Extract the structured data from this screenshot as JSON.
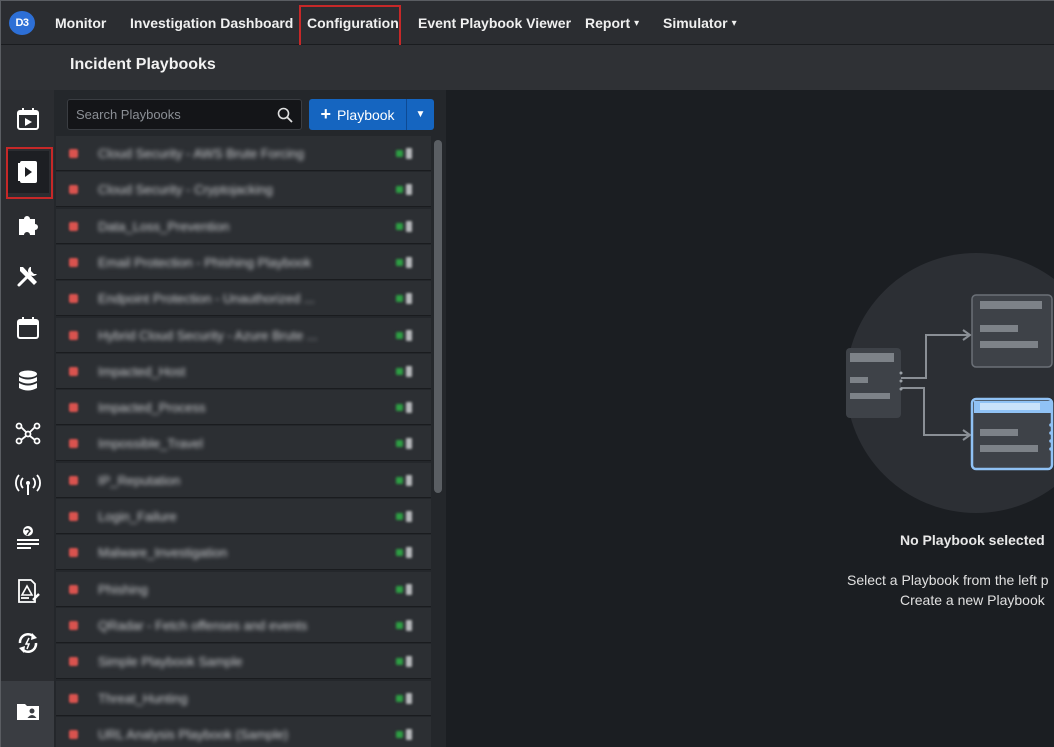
{
  "app": {
    "logo_text": "D3",
    "nav": [
      {
        "label": "Monitor",
        "has_caret": false
      },
      {
        "label": "Investigation Dashboard",
        "has_caret": false
      },
      {
        "label": "Configuration",
        "has_caret": false
      },
      {
        "label": "Event Playbook Viewer",
        "has_caret": false
      },
      {
        "label": "Report",
        "has_caret": true
      },
      {
        "label": "Simulator",
        "has_caret": true
      }
    ],
    "caret_glyph": "▾"
  },
  "page": {
    "title": "Incident Playbooks"
  },
  "sidebar": {
    "icons": [
      "calendar-play-icon",
      "playbook-icon",
      "puzzle-icon",
      "tools-icon",
      "calendar-icon",
      "database-icon",
      "network-icon",
      "antenna-icon",
      "globe-list-icon",
      "report-edit-icon",
      "sync-icon",
      "folder-user-icon"
    ],
    "active_index": 1
  },
  "playbooks_panel": {
    "search_placeholder": "Search Playbooks",
    "add_button_label": "Playbook",
    "add_button_plus": "+",
    "add_dropdown_glyph": "▼",
    "items": [
      {
        "name": "Cloud Security - AWS Brute Forcing"
      },
      {
        "name": "Cloud Security - Cryptojacking"
      },
      {
        "name": "Data_Loss_Prevention"
      },
      {
        "name": "Email Protection - Phishing Playbook"
      },
      {
        "name": "Endpoint Protection - Unauthorized ..."
      },
      {
        "name": "Hybrid Cloud Security - Azure Brute ..."
      },
      {
        "name": "Impacted_Host"
      },
      {
        "name": "Impacted_Process"
      },
      {
        "name": "Impossible_Travel"
      },
      {
        "name": "IP_Reputation"
      },
      {
        "name": "Login_Failure"
      },
      {
        "name": "Malware_Investigation"
      },
      {
        "name": "Phishing"
      },
      {
        "name": "QRadar - Fetch offenses and events"
      },
      {
        "name": "Simple Playbook Sample"
      },
      {
        "name": "Threat_Hunting"
      },
      {
        "name": "URL Analysis Playbook (Sample)"
      }
    ]
  },
  "empty_state": {
    "title": "No Playbook selected",
    "line1": "Select a Playbook from the left p",
    "line2": "Create a new Playbook"
  },
  "colors": {
    "accent": "#1565c0",
    "highlight_border": "#c62828",
    "status_red": "#d9534f",
    "status_green": "#2e9e44",
    "illustration_blue": "#90c2f5"
  }
}
